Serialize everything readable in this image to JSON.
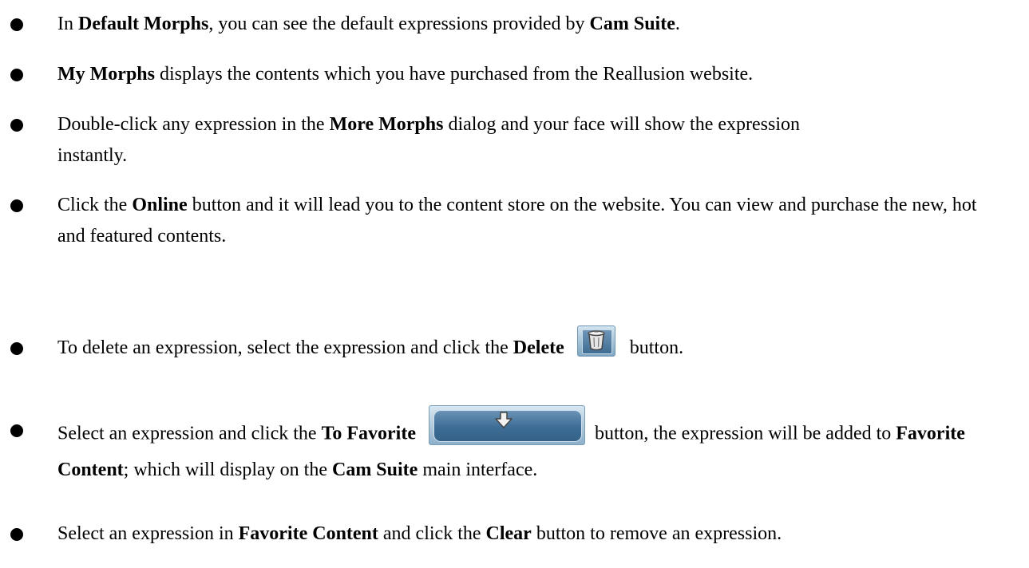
{
  "bullets": [
    {
      "segments": [
        {
          "text": "In ",
          "bold": false
        },
        {
          "text": "Default Morphs",
          "bold": true
        },
        {
          "text": ", you can see the default expressions provided by ",
          "bold": false
        },
        {
          "text": "Cam Suite",
          "bold": true
        },
        {
          "text": ".",
          "bold": false
        }
      ]
    },
    {
      "segments": [
        {
          "text": "My Morphs",
          "bold": true
        },
        {
          "text": " displays the contents which you have purchased from the Reallusion website.",
          "bold": false
        }
      ]
    },
    {
      "segments": [
        {
          "text": "Double-click any expression in the ",
          "bold": false
        },
        {
          "text": "More Morphs",
          "bold": true
        },
        {
          "text": " dialog and your face will show the expression instantly.",
          "bold": false
        }
      ]
    },
    {
      "segments": [
        {
          "text": "Click the ",
          "bold": false
        },
        {
          "text": "Online",
          "bold": true
        },
        {
          "text": " button and it will lead you to the content store on the website. You can view and purchase the new, hot and featured contents.",
          "bold": false
        }
      ]
    },
    {
      "segments": [
        {
          "text": "To delete an expression, select the expression and click the ",
          "bold": false
        },
        {
          "text": "Delete",
          "bold": true
        },
        {
          "icon": "trash-can-icon"
        },
        {
          "text": "button.",
          "bold": false
        }
      ]
    },
    {
      "segments": [
        {
          "text": "Select an expression and click the ",
          "bold": false
        },
        {
          "text": "To Favorite",
          "bold": true
        },
        {
          "icon": "down-arrow-icon"
        },
        {
          "text": "button, the expression will be added to ",
          "bold": false
        },
        {
          "text": "Favorite Content",
          "bold": true
        },
        {
          "text": "; which will display on the ",
          "bold": false
        },
        {
          "text": "Cam Suite",
          "bold": true
        },
        {
          "text": " main interface.",
          "bold": false
        }
      ]
    },
    {
      "segments": [
        {
          "text": "Select an expression in ",
          "bold": false
        },
        {
          "text": "Favorite Content",
          "bold": true
        },
        {
          "text": " and click the ",
          "bold": false
        },
        {
          "text": "Clear",
          "bold": true
        },
        {
          "text": " button to remove an expression.",
          "bold": false
        }
      ]
    }
  ]
}
